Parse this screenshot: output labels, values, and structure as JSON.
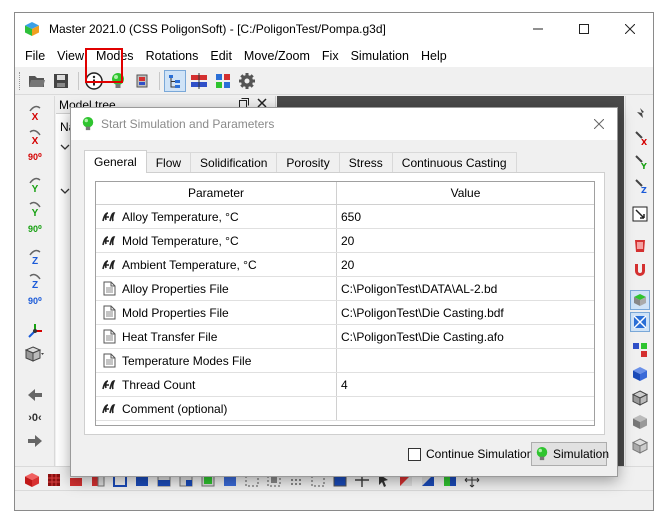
{
  "window": {
    "title": "Master 2021.0 (CSS PoligonSoft) - [C:/PoligonTest/Pompa.g3d]"
  },
  "menu": [
    "File",
    "View",
    "Modes",
    "Rotations",
    "Edit",
    "Move/Zoom",
    "Fix",
    "Simulation",
    "Help"
  ],
  "model_tree": {
    "title": "Model tree",
    "row_label": "Na"
  },
  "left_toolbar": {
    "x_label": "X",
    "y_label": "Y",
    "z_label": "Z",
    "deg_label": "90⁰",
    "nav_label": "›0‹"
  },
  "dialog": {
    "title": "Start Simulation and Parameters",
    "tabs": [
      "General",
      "Flow",
      "Solidification",
      "Porosity",
      "Stress",
      "Continuous Casting"
    ],
    "active_tab": "General",
    "columns": {
      "parameter": "Parameter",
      "value": "Value"
    },
    "rows": [
      {
        "icon": "gl-icon",
        "parameter": "Alloy Temperature, °C",
        "value": "650"
      },
      {
        "icon": "gl-icon",
        "parameter": "Mold Temperature, °C",
        "value": "20"
      },
      {
        "icon": "gl-icon",
        "parameter": "Ambient Temperature, °C",
        "value": "20"
      },
      {
        "icon": "file-icon",
        "parameter": "Alloy Properties File",
        "value": "C:\\PoligonTest\\DATA\\AL-2.bd"
      },
      {
        "icon": "file-icon",
        "parameter": "Mold Properties File",
        "value": "C:\\PoligonTest\\Die Casting.bdf"
      },
      {
        "icon": "file-icon",
        "parameter": "Heat Transfer File",
        "value": "C:\\PoligonTest\\Die Casting.afo"
      },
      {
        "icon": "file-icon",
        "parameter": "Temperature Modes File",
        "value": ""
      },
      {
        "icon": "gl-icon",
        "parameter": "Thread Count",
        "value": "4"
      },
      {
        "icon": "gl-icon",
        "parameter": "Comment (optional)",
        "value": ""
      }
    ],
    "continue_label": "Continue Simulation",
    "continue_checked": false,
    "simulation_button": "Simulation"
  },
  "colors": {
    "highlight": "#e00000",
    "bulb": "#2fc42f",
    "viewport": "#4a4a4a"
  }
}
